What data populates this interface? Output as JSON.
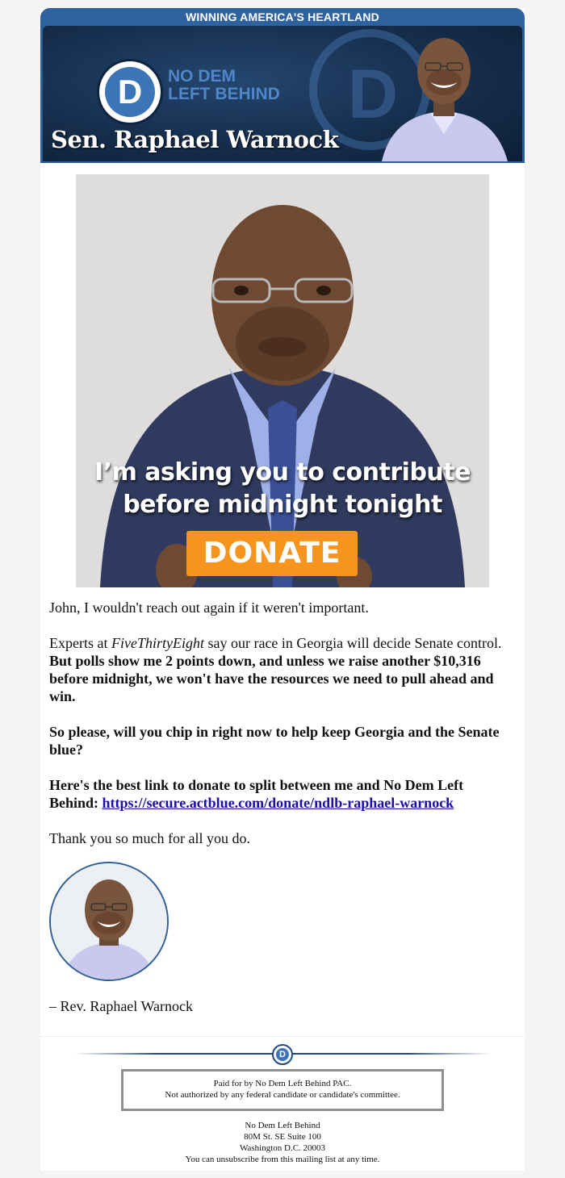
{
  "header": {
    "tagline": "WINNING AMERICA'S HEARTLAND",
    "org_name_line1": "NO DEM",
    "org_name_line2": "LEFT BEHIND",
    "senator_name": "Sen. Raphael Warnock",
    "logo_icon": "d-logo-icon",
    "accent_color": "#2f63a0"
  },
  "hero": {
    "caption_line1": "I’m asking you to contribute",
    "caption_line2": "before midnight tonight",
    "donate_label": "DONATE",
    "donate_color": "#f7941d"
  },
  "body": {
    "p1": "John, I wouldn't reach out again if it weren't important.",
    "p2_prefix": "Experts at ",
    "p2_source": "FiveThirtyEight",
    "p2_middle": " say our race in Georgia will decide Senate control. ",
    "p2_bold": "But polls show me 2 points down, and unless we raise another $10,316 before midnight, we won't have the resources we need to pull ahead and win.",
    "p3": "So please, will you chip in right now to help keep Georgia and the Senate blue?",
    "p4_text": "Here's the best link to donate to split between me and No Dem Left Behind: ",
    "p4_link": "https://secure.actblue.com/donate/ndlb-raphael-warnock",
    "p5": "Thank you so much for all you do.",
    "signoff": "– Rev. Raphael Warnock"
  },
  "footer": {
    "disclaimer_line1": "Paid for by No Dem Left Behind PAC.",
    "disclaimer_line2": "Not authorized by any federal candidate or candidate's committee.",
    "address_line1": "No Dem Left Behind",
    "address_line2": "80M St. SE Suite 100",
    "address_line3": "Washington D.C. 20003",
    "unsubscribe": "You can unsubscribe from this mailing list at any time."
  }
}
